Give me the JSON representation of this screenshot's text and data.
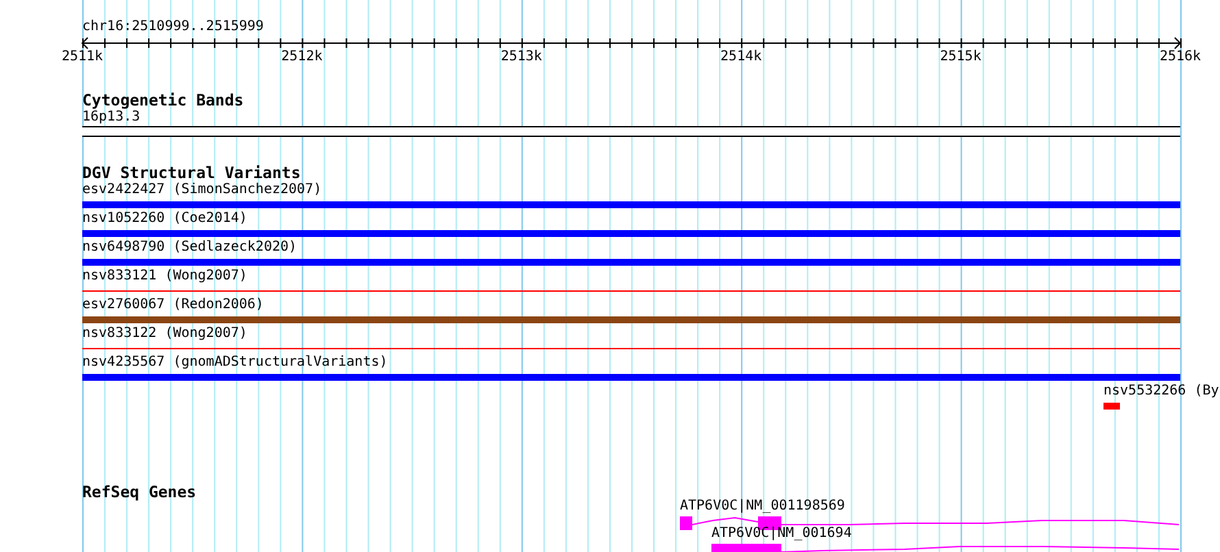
{
  "location": "chr16:2510999..2515999",
  "axis": {
    "ticks": [
      "2511k",
      "2512k",
      "2513k",
      "2514k",
      "2515k",
      "2516k"
    ]
  },
  "cytogenetic_bands": {
    "title": "Cytogenetic Bands",
    "bands": [
      {
        "label": "16p13.3"
      }
    ]
  },
  "dgv_structural_variants": {
    "title": "DGV Structural Variants",
    "variants": [
      {
        "label": "esv2422427 (SimonSanchez2007)",
        "kind": "bar",
        "color": "#0000ff"
      },
      {
        "label": "nsv1052260 (Coe2014)",
        "kind": "bar",
        "color": "#0000ff"
      },
      {
        "label": "nsv6498790 (Sedlazeck2020)",
        "kind": "bar",
        "color": "#0000ff"
      },
      {
        "label": "nsv833121 (Wong2007)",
        "kind": "line",
        "color": "#ff0000"
      },
      {
        "label": "esv2760067 (Redon2006)",
        "kind": "bar",
        "color": "#8b4513"
      },
      {
        "label": "nsv833122 (Wong2007)",
        "kind": "line",
        "color": "#ff0000"
      },
      {
        "label": "nsv4235567 (gnomADStructuralVariants)",
        "kind": "bar",
        "color": "#0000ff"
      },
      {
        "label": "nsv5532266 (By",
        "kind": "bar",
        "color": "#ff0000"
      }
    ]
  },
  "refseq_genes": {
    "title": "RefSeq Genes",
    "genes": [
      {
        "label": "ATP6V0C|NM_001198569"
      },
      {
        "label": "ATP6V0C|NM_001694"
      }
    ]
  }
}
